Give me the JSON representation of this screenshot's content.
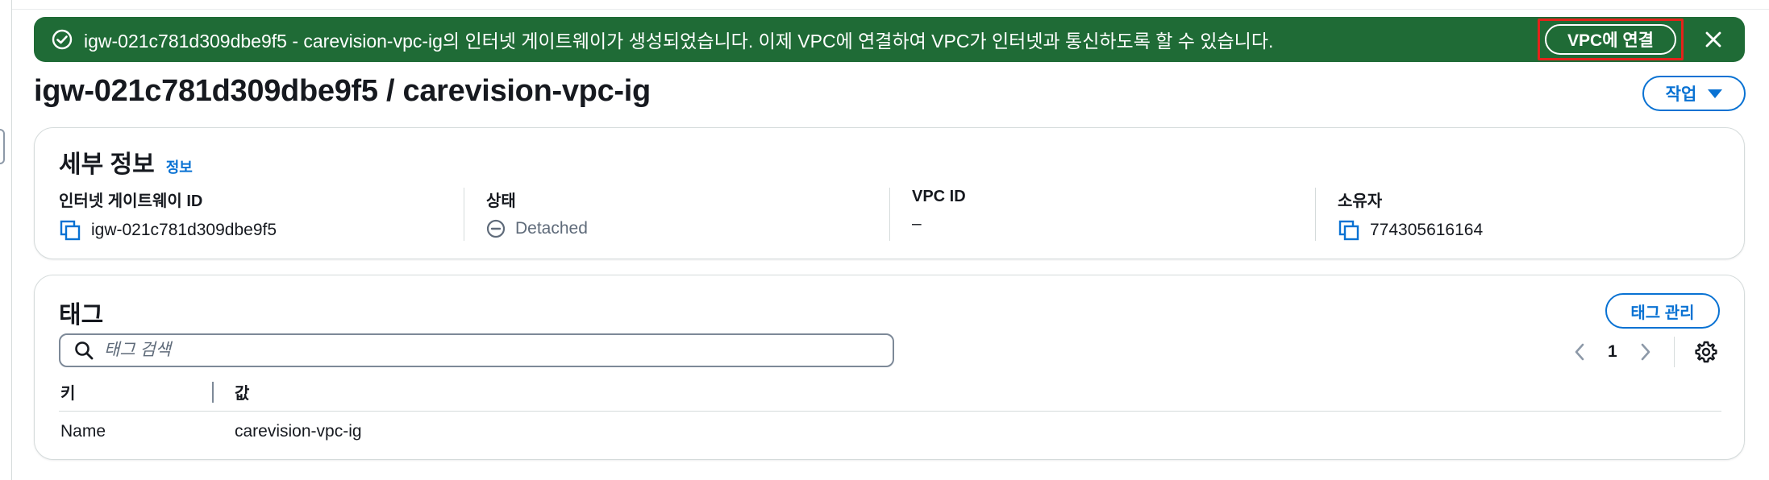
{
  "flash": {
    "message": "igw-021c781d309dbe9f5 - carevision-vpc-ig의 인터넷 게이트웨이가 생성되었습니다. 이제 VPC에 연결하여 VPC가 인터넷과 통신하도록 할 수 있습니다.",
    "action_label": "VPC에 연결",
    "status_color": "#1f6b36",
    "highlight_color": "#e3231b",
    "icons": {
      "status": "check-circle-icon",
      "dismiss": "close-icon"
    }
  },
  "header": {
    "title": "igw-021c781d309dbe9f5 / carevision-vpc-ig",
    "actions_label": "작업"
  },
  "details": {
    "heading": "세부 정보",
    "info_label": "정보",
    "fields": [
      {
        "label": "인터넷 게이트웨이 ID",
        "value": "igw-021c781d309dbe9f5",
        "icon": "copy-icon"
      },
      {
        "label": "상태",
        "value": "Detached",
        "icon": "status-stopped-icon"
      },
      {
        "label": "VPC ID",
        "value": "–"
      },
      {
        "label": "소유자",
        "value": "774305616164",
        "icon": "copy-icon"
      }
    ]
  },
  "tags": {
    "heading": "태그",
    "manage_label": "태그 관리",
    "search_placeholder": "태그 검색",
    "search_value": "",
    "page": "1",
    "columns": [
      "키",
      "값"
    ],
    "rows": [
      {
        "key": "Name",
        "value": "carevision-vpc-ig"
      }
    ]
  },
  "colors": {
    "accent": "#0972d3",
    "text": "#16191f",
    "muted": "#5f6b7a"
  }
}
